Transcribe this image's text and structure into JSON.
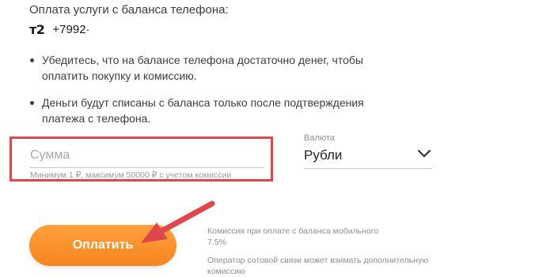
{
  "payment": {
    "header": "Оплата услуги с баланса телефона:",
    "operator_logo": "т2",
    "phone": "+7992·"
  },
  "notes": [
    "Убедитесь, что на балансе телефона достаточно денег, чтобы оплатить покупку и комиссию.",
    "Деньги будут списаны с баланса только после подтверждения платежа с телефона."
  ],
  "amount": {
    "placeholder": "Сумма",
    "value": "",
    "hint": "Минимум 1 ₽, максимум 50000 ₽ с учетом комиссии"
  },
  "currency": {
    "label": "Валюта",
    "selected": "Рубли",
    "icon": "chevron-down-icon"
  },
  "pay_button": {
    "label": "Оплатить"
  },
  "fee_info": {
    "line1": "Комиссия при оплате с баланса мобильного",
    "line2": "7.5%",
    "operator_note": "Оператор сотовой связи может взимать дополнительную комиссию"
  },
  "annotations": {
    "highlight_color": "#e0474c",
    "arrow_color": "#e0474c",
    "button_color": "#f7851e"
  }
}
